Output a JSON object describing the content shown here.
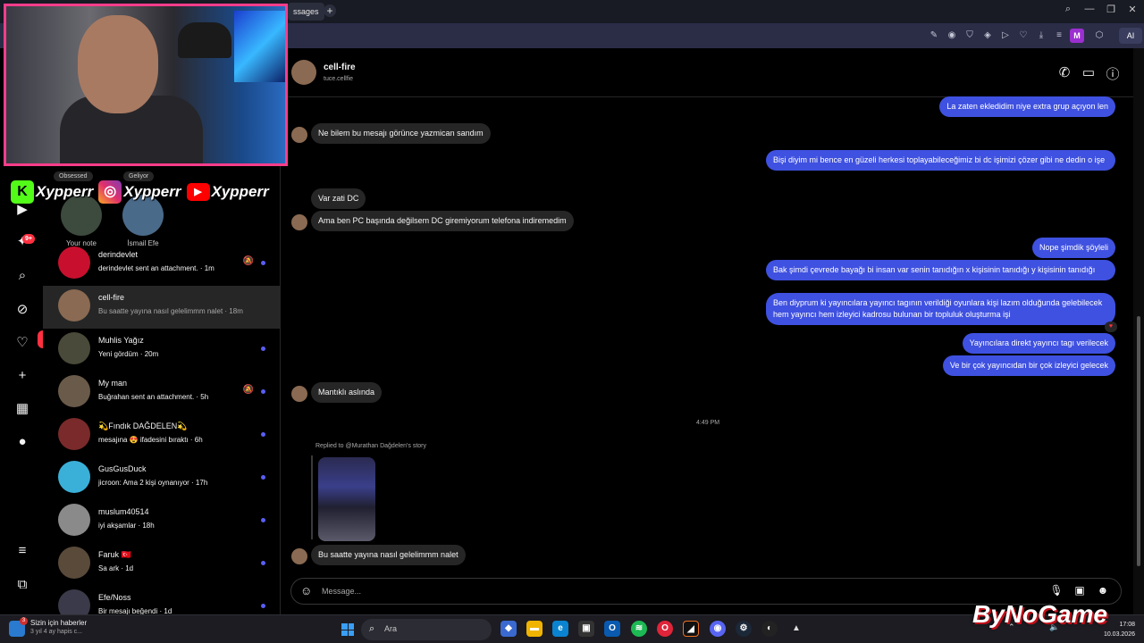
{
  "browser": {
    "tab_label": "ssages",
    "window_controls": [
      "search-icon",
      "minimize-icon",
      "restore-icon",
      "close-icon"
    ],
    "profile_badge": "M",
    "ai_label": "AI"
  },
  "overlay": {
    "social_handle_1": "Xypperr",
    "social_handle_2": "Xypperr",
    "social_handle_3": "Xypperr"
  },
  "rail": {
    "notification_count": "9+",
    "heart_count": "1"
  },
  "notes": {
    "your_note_label": "Your note",
    "your_note_text": "Obsessed",
    "friend_note_label": "İsmail Efe",
    "friend_note_text": "Geliyor"
  },
  "conversations": [
    {
      "name": "derindevlet",
      "preview": "derindevlet sent an attachment. · 1m",
      "muted": true,
      "unread": true,
      "color": "#c8102e"
    },
    {
      "name": "cell-fire",
      "preview": "Bu saatte yayına nasıl gelelimmm nalet · 18m",
      "muted": false,
      "unread": false,
      "color": "#8a6a52",
      "active": true
    },
    {
      "name": "Muhlis Yağız",
      "preview": "Yeni gördüm · 20m",
      "muted": false,
      "unread": true,
      "color": "#4a4a3a"
    },
    {
      "name": "My man",
      "preview": "Buğrahan sent an attachment. · 5h",
      "muted": true,
      "unread": true,
      "color": "#6a5a4a"
    },
    {
      "name": "💫Fındık DAĞDELEN💫",
      "preview": "mesajına 😍 ifadesini bıraktı · 6h",
      "muted": false,
      "unread": true,
      "color": "#7a2a2a"
    },
    {
      "name": "GusGusDuck",
      "preview": "jicroon: Ama 2 kişi oynanıyor · 17h",
      "muted": false,
      "unread": true,
      "color": "#3ab0d8"
    },
    {
      "name": "muslum40514",
      "preview": "iyi akşamlar · 18h",
      "muted": false,
      "unread": true,
      "color": "#8a8a8a"
    },
    {
      "name": "Faruk 🇹🇷",
      "preview": "Sa ark · 1d",
      "muted": false,
      "unread": true,
      "color": "#5a4a3a"
    },
    {
      "name": "Efe/Noss",
      "preview": "Bir mesajı beğendi · 1d",
      "muted": false,
      "unread": true,
      "color": "#3a3a4a"
    }
  ],
  "chat": {
    "name": "cell-fire",
    "username": "tuce.cellfie",
    "messages": {
      "m1": "La zaten ekledidim niye extra grup açıyon len",
      "m2": "Ne bilem bu mesajı görünce yazmican sandım",
      "m3": "Bişi diyim mi bence en güzeli herkesi toplayabileceğimiz bi dc işimizi çözer gibi ne dedin o işe",
      "m4": "Var zati DC",
      "m5": "Ama ben PC başında değilsem DC giremiyorum telefona indiremedim",
      "m6": "Nope şimdik şöyleli",
      "m7": "Bak şimdi çevrede bayağı bi insan var senin tanıdığın x kişisinin tanıdığı y kişisinin tanıdığı",
      "m8": "Ben diyprum ki yayıncılara yayıncı tagının verildiği oyunlara kişi lazım olduğunda gelebilecek hem yayıncı hem izleyici kadrosu bulunan bir topluluk oluşturma işi",
      "m9": "Yayıncılara direkt yayıncı tagı verilecek",
      "m10": "Ve bir çok yayıncıdan bir çok izleyici gelecek",
      "m11": "Mantıklı aslında",
      "m12": "Bu saatte yayına nasıl gelelimmm nalet"
    },
    "timestamp": "4:49 PM",
    "replied_to": "Replied to @Murathan Dağdelen's story",
    "composer_placeholder": "Message..."
  },
  "taskbar": {
    "news_title": "Sizin için haberler",
    "news_sub": "3 yıl 4 ay hapis c...",
    "news_badge": "3",
    "search_label": "Ara",
    "time": "17:08",
    "date": "10.03.2026"
  },
  "watermark": "ByNoGame"
}
